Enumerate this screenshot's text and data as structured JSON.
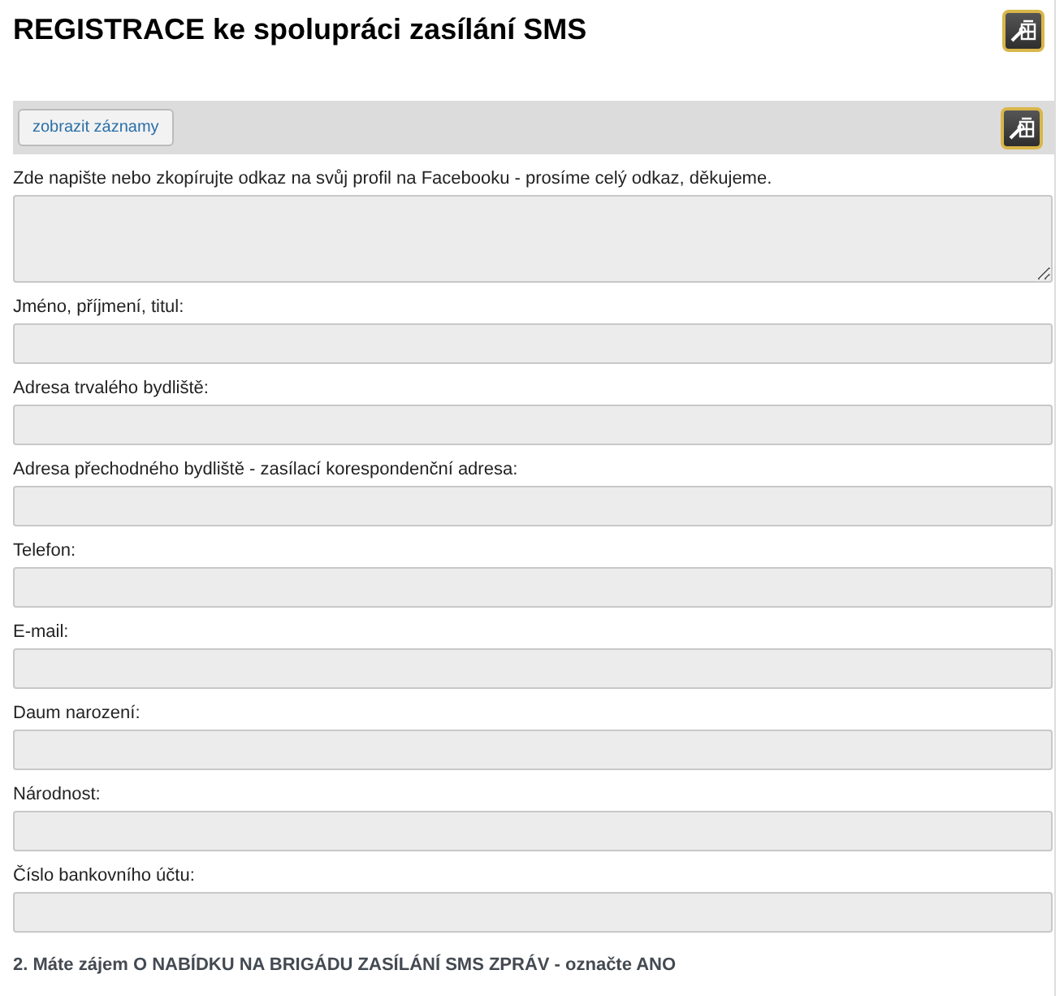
{
  "title": "REGISTRACE ke spolupráci zasílání SMS",
  "toolbar": {
    "button": "zobrazit záznamy"
  },
  "fields": [
    {
      "kind": "textarea",
      "label": "Zde napište nebo zkopírujte odkaz na svůj profil na Facebooku - prosíme celý odkaz, děkujeme."
    },
    {
      "kind": "text",
      "label": "Jméno, příjmení, titul:"
    },
    {
      "kind": "text",
      "label": "Adresa trvalého bydliště:"
    },
    {
      "kind": "text",
      "label": "Adresa přechodného bydliště - zasílací korespondenční adresa:"
    },
    {
      "kind": "text",
      "label": "Telefon:"
    },
    {
      "kind": "text",
      "label": "E-mail:"
    },
    {
      "kind": "text",
      "label": "Daum narození:"
    },
    {
      "kind": "text",
      "label": "Národnost:"
    },
    {
      "kind": "text",
      "label": "Číslo bankovního účtu:"
    }
  ],
  "section_heading": "2. Máte zájem O NABÍDKU NA BRIGÁDU ZASÍLÁNÍ SMS ZPRÁV - označte ANO"
}
